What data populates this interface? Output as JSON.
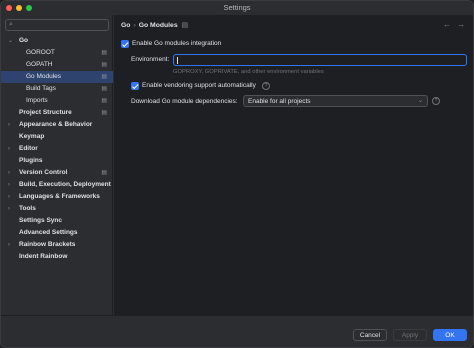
{
  "window": {
    "title": "Settings"
  },
  "sidebar": {
    "search_placeholder": "",
    "search_icon": "search-icon",
    "items": [
      {
        "label": "Go",
        "level": 0,
        "expanded": true,
        "bold": true,
        "chevron": "⌄",
        "pin": ""
      },
      {
        "label": "GOROOT",
        "level": 1,
        "pin": "▤"
      },
      {
        "label": "GOPATH",
        "level": 1,
        "pin": "▤"
      },
      {
        "label": "Go Modules",
        "level": 1,
        "selected": true,
        "pin": "▤"
      },
      {
        "label": "Build Tags",
        "level": 1,
        "pin": "▤"
      },
      {
        "label": "Imports",
        "level": 1,
        "pin": "▤"
      },
      {
        "label": "Project Structure",
        "level": 0,
        "bold": true,
        "pin": "▤"
      },
      {
        "label": "Appearance & Behavior",
        "level": 0,
        "bold": true,
        "chevron": "›"
      },
      {
        "label": "Keymap",
        "level": 0,
        "bold": true
      },
      {
        "label": "Editor",
        "level": 0,
        "bold": true,
        "chevron": "›"
      },
      {
        "label": "Plugins",
        "level": 0,
        "bold": true
      },
      {
        "label": "Version Control",
        "level": 0,
        "bold": true,
        "chevron": "›",
        "pin": "▤"
      },
      {
        "label": "Build, Execution, Deployment",
        "level": 0,
        "bold": true,
        "chevron": "›"
      },
      {
        "label": "Languages & Frameworks",
        "level": 0,
        "bold": true,
        "chevron": "›"
      },
      {
        "label": "Tools",
        "level": 0,
        "bold": true,
        "chevron": "›"
      },
      {
        "label": "Settings Sync",
        "level": 0,
        "bold": true
      },
      {
        "label": "Advanced Settings",
        "level": 0,
        "bold": true
      },
      {
        "label": "Rainbow Brackets",
        "level": 0,
        "bold": true,
        "chevron": "›"
      },
      {
        "label": "Indent Rainbow",
        "level": 0,
        "bold": true
      }
    ],
    "help_label": "?"
  },
  "content": {
    "breadcrumb": {
      "parent": "Go",
      "separator": "›",
      "current": "Go Modules",
      "pin": "▤"
    },
    "nav_back": "←",
    "nav_forward": "→",
    "enable_modules_label": "Enable Go modules integration",
    "environment_label": "Environment:",
    "environment_value": "",
    "environment_hint": "GOPROXY, GOPRIVATE, and other environment variables",
    "vendoring_label": "Enable vendoring support automatically",
    "help_icon_glyph": "?",
    "download_label": "Download Go module dependencies:",
    "download_value": "Enable for all projects",
    "download_arrow": "⌄"
  },
  "footer": {
    "cancel_label": "Cancel",
    "apply_label": "Apply",
    "ok_label": "OK"
  },
  "colors": {
    "accent": "#3574f0",
    "selection": "#2e436e",
    "background": "#1e1f22",
    "panel": "#2b2d30"
  }
}
